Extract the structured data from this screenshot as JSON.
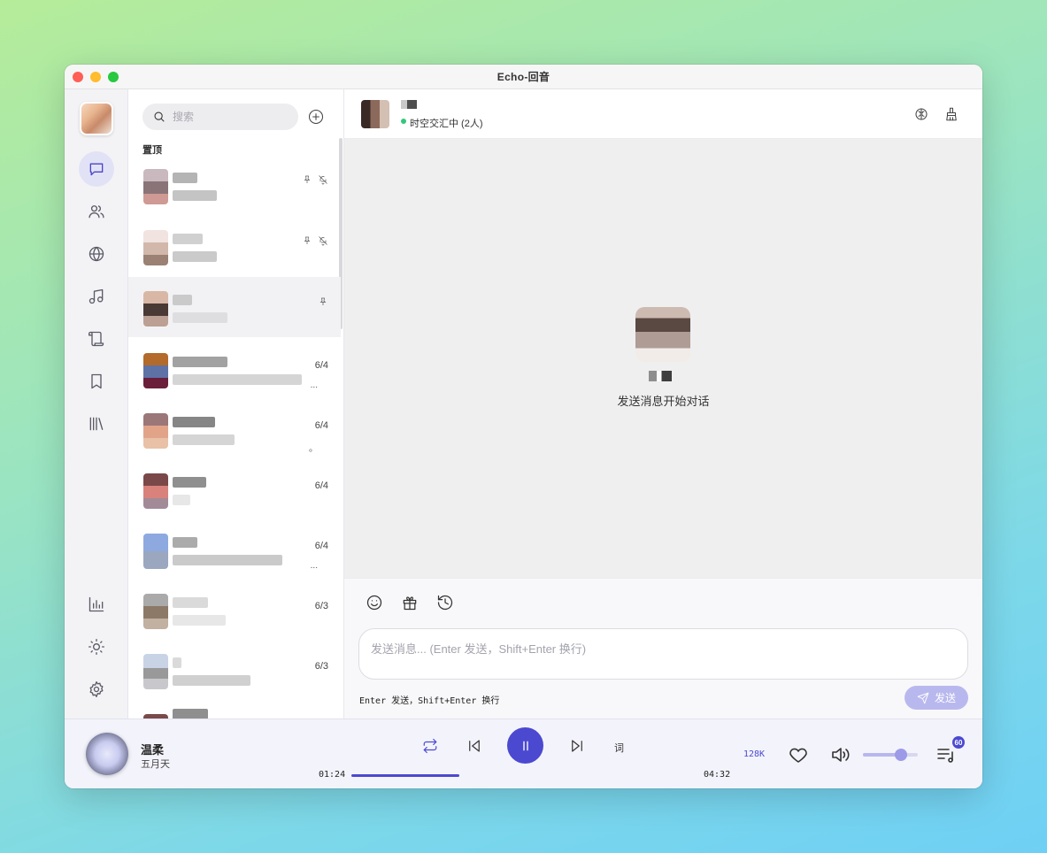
{
  "window": {
    "title": "Echo-回音"
  },
  "sidebar": {
    "nav": [
      {
        "icon": "message-icon",
        "active": true
      },
      {
        "icon": "users-icon",
        "active": false
      },
      {
        "icon": "globe-icon",
        "active": false
      },
      {
        "icon": "music-note-icon",
        "active": false
      },
      {
        "icon": "scroll-icon",
        "active": false
      },
      {
        "icon": "bookmark-icon",
        "active": false
      },
      {
        "icon": "library-icon",
        "active": false
      }
    ],
    "bottom": [
      {
        "icon": "chart-icon"
      },
      {
        "icon": "sun-icon"
      },
      {
        "icon": "gear-icon"
      }
    ]
  },
  "conversations": {
    "search_placeholder": "搜索",
    "pinned_label": "置顶",
    "items": [
      {
        "date": "",
        "pinned": true,
        "muted": true
      },
      {
        "date": "",
        "pinned": true,
        "muted": true
      },
      {
        "date": "",
        "pinned": true,
        "muted": false
      },
      {
        "date": "6/4",
        "snippet": "..."
      },
      {
        "date": "6/4",
        "snippet": "。"
      },
      {
        "date": "6/4",
        "snippet": ""
      },
      {
        "date": "6/4",
        "snippet": "..."
      },
      {
        "date": "6/3",
        "snippet": ""
      },
      {
        "date": "6/3",
        "snippet": ""
      }
    ]
  },
  "chat": {
    "status": "时空交汇中 (2人)",
    "empty_text": "发送消息开始对话",
    "input_placeholder": "发送消息... (Enter 发送，Shift+Enter 换行)",
    "hint": "Enter 发送，Shift+Enter 换行",
    "send_label": "发送",
    "colors": {
      "accent": "#4b49d0",
      "online": "#34c77b"
    }
  },
  "player": {
    "title": "温柔",
    "artist": "五月天",
    "current_time": "01:24",
    "total_time": "04:32",
    "progress": 0.309,
    "lyric_label": "词",
    "quality": "128K",
    "volume": 0.7,
    "queue_count": "60"
  }
}
